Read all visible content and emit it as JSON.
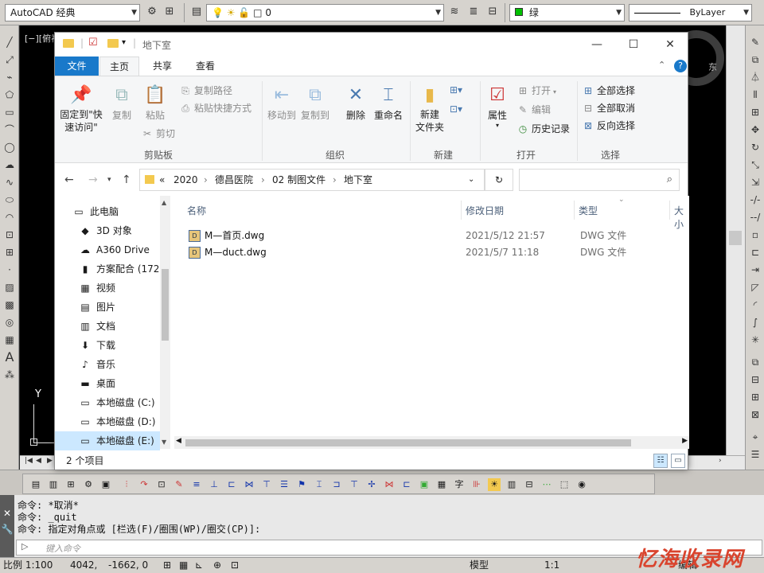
{
  "cad": {
    "workspace": "AutoCAD 经典",
    "layer_value": "0",
    "color_value": "绿",
    "linetype_value": "ByLayer",
    "view_label": "[−][俯视",
    "compass_east": "东",
    "ucs_y_label": "Y",
    "command_history": [
      "命令: *取消*",
      "命令: _quit",
      "命令: 指定对角点或 [栏选(F)/圈围(WP)/圈交(CP)]:"
    ],
    "command_prompt_icon": "▷",
    "command_placeholder": "键入命令",
    "status": {
      "scale": "比例 1:100",
      "coord_x": "4042,",
      "coord_y": "-1662, 0",
      "model": "模型",
      "anno_scale": "1:1",
      "edit_label": "编辑"
    },
    "watermark": "忆海收录网"
  },
  "explorer": {
    "title": "地下室",
    "tabs": [
      "文件",
      "主页",
      "共享",
      "查看"
    ],
    "ribbon": {
      "clipboard": {
        "pin_label": "固定到\"快\n速访问\"",
        "copy_label": "复制",
        "paste_label": "粘贴",
        "copy_path": "复制路径",
        "paste_shortcut": "粘贴快捷方式",
        "cut": "剪切",
        "group": "剪贴板"
      },
      "organize": {
        "move_to": "移动到",
        "copy_to": "复制到",
        "delete": "删除",
        "rename": "重命名",
        "group": "组织"
      },
      "new": {
        "new_folder": "新建\n文件夹",
        "group": "新建"
      },
      "open": {
        "properties": "属性",
        "open": "打开",
        "edit": "编辑",
        "history": "历史记录",
        "group": "打开"
      },
      "select": {
        "select_all": "全部选择",
        "select_none": "全部取消",
        "invert": "反向选择",
        "group": "选择"
      }
    },
    "address": {
      "overflow": "«",
      "segments": [
        "2020",
        "德昌医院",
        "02 制图文件",
        "地下室"
      ]
    },
    "search_placeholder": "",
    "nav": [
      {
        "label": "此电脑",
        "icon": "computer-icon",
        "glyph": "▭"
      },
      {
        "label": "3D 对象",
        "icon": "cube-icon",
        "glyph": "◆"
      },
      {
        "label": "A360 Drive",
        "icon": "cloud-icon",
        "glyph": "☁"
      },
      {
        "label": "方案配合 (172",
        "icon": "network-folder-icon",
        "glyph": "▮"
      },
      {
        "label": "视频",
        "icon": "video-icon",
        "glyph": "▦"
      },
      {
        "label": "图片",
        "icon": "picture-icon",
        "glyph": "▤"
      },
      {
        "label": "文档",
        "icon": "document-icon",
        "glyph": "▥"
      },
      {
        "label": "下载",
        "icon": "download-icon",
        "glyph": "⬇"
      },
      {
        "label": "音乐",
        "icon": "music-icon",
        "glyph": "♪"
      },
      {
        "label": "桌面",
        "icon": "desktop-icon",
        "glyph": "▬"
      },
      {
        "label": "本地磁盘 (C:)",
        "icon": "drive-icon",
        "glyph": "▭"
      },
      {
        "label": "本地磁盘 (D:)",
        "icon": "drive-icon",
        "glyph": "▭"
      },
      {
        "label": "本地磁盘 (E:)",
        "icon": "drive-icon",
        "glyph": "▭"
      }
    ],
    "columns": [
      "名称",
      "修改日期",
      "类型",
      "大小"
    ],
    "files": [
      {
        "name": "M—首页.dwg",
        "date": "2021/5/12 21:57",
        "type": "DWG 文件"
      },
      {
        "name": "M—duct.dwg",
        "date": "2021/5/7 11:18",
        "type": "DWG 文件"
      }
    ],
    "item_count": "2 个项目"
  },
  "colors": {
    "file_tab": "#1979ca",
    "selected": "#cce8ff",
    "cad_canvas": "#000000",
    "watermark": "#d9442e"
  }
}
